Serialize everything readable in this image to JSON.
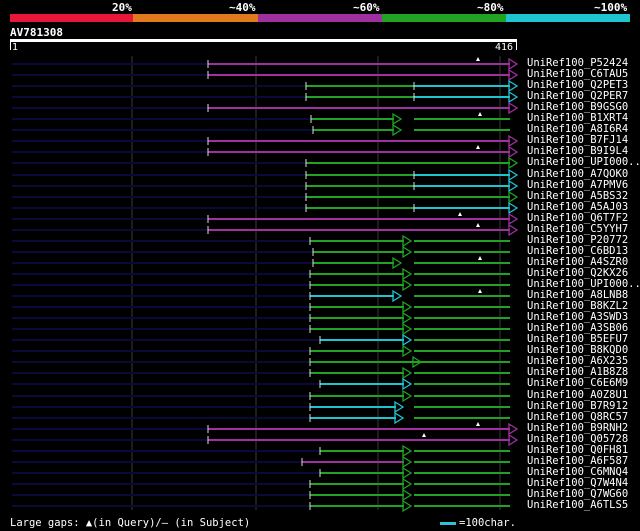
{
  "colors": {
    "band_lt20": "#e8173a",
    "band_20_40": "#e07a1c",
    "band_40_60": "#a030a0",
    "band_60_80": "#22a222",
    "band_80_100": "#1ec4d0",
    "query_line": "#ffffff",
    "left_line": "#0a0a3a",
    "grid": "#3a3a3a"
  },
  "identity_legend": [
    "20%",
    "~40%",
    "~60%",
    "~80%",
    "~100%"
  ],
  "query": {
    "name": "AV781308",
    "start": "1",
    "end": "416"
  },
  "hits": [
    "UniRef100_P52424",
    "UniRef100_C6TAU5",
    "UniRef100_Q2PET3",
    "UniRef100_Q2PER7",
    "UniRef100_B9GSG0",
    "UniRef100_B1XRT4",
    "UniRef100_A8I6R4",
    "UniRef100_B7FJ14",
    "UniRef100_B9I9L4",
    "UniRef100_UPI000...",
    "UniRef100_A7QOK0",
    "UniRef100_A7PMV6",
    "UniRef100_A5BS32",
    "UniRef100_A5AJ03",
    "UniRef100_Q6T7F2",
    "UniRef100_C5YYH7",
    "UniRef100_P20772",
    "UniRef100_C6BD13",
    "UniRef100_A4SZR0",
    "UniRef100_Q2KX26",
    "UniRef100_UPI000...",
    "UniRef100_A8LNB8",
    "UniRef100_B8KZL2",
    "UniRef100_A3SWD3",
    "UniRef100_A3SB06",
    "UniRef100_B5EFU7",
    "UniRef100_B8KQD0",
    "UniRef100_A6X235",
    "UniRef100_A1B8Z8",
    "UniRef100_C6E6M9",
    "UniRef100_A0Z8U1",
    "UniRef100_B7R912",
    "UniRef100_Q8RC57",
    "UniRef100_B9RNH2",
    "UniRef100_Q05728",
    "UniRef100_Q0FH81",
    "UniRef100_A6F587",
    "UniRef100_C6MNQ4",
    "UniRef100_Q7W4N4",
    "UniRef100_Q7WG60",
    "UniRef100_A6TLS5"
  ],
  "legend": {
    "gaps": "Large gaps: ▲(in Query)/– (in Subject)",
    "scale": "=100char."
  }
}
